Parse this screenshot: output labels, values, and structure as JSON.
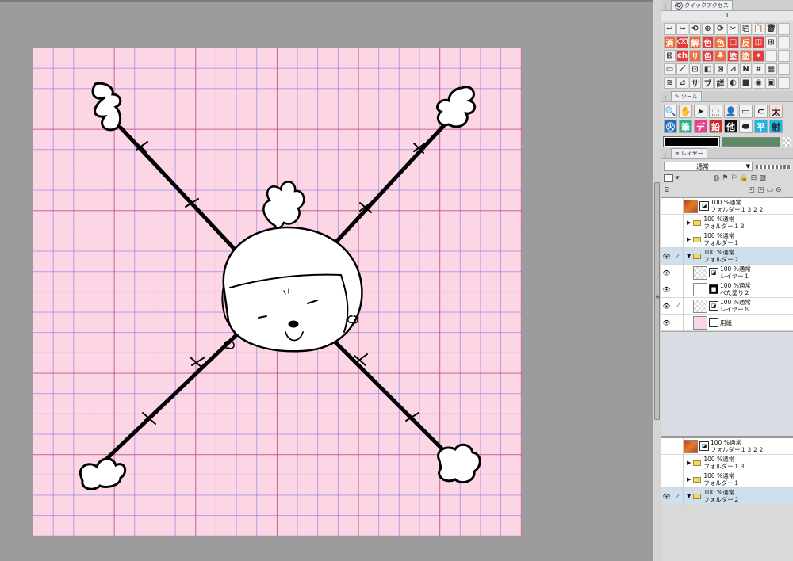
{
  "canvas": {
    "paper_color": "#fdd6e6",
    "ink_color": "#000000"
  },
  "quick_access": {
    "tab_label": "クイックアクセス",
    "set_number": "1",
    "rows": [
      [
        "↩",
        "↪",
        "⟲",
        "⊕",
        "⟳",
        "✂",
        "⎘",
        "📋",
        "🗑",
        "",
        ""
      ],
      [
        "消",
        "⌫",
        "解",
        "色",
        "色",
        "□",
        "反",
        "◫",
        "⊞",
        "",
        ""
      ],
      [
        "⊠",
        "ch",
        "サ",
        "色",
        "♣",
        "塗",
        "塗",
        "⌖",
        "",
        "",
        ""
      ],
      [
        "▭",
        "⟋",
        "⊡",
        "◧",
        "⊠",
        "⊿",
        "N",
        "⌗",
        "▦",
        "",
        ""
      ],
      [
        "≋",
        "⊿",
        "サ",
        "ブ",
        "詳",
        "◐",
        "■",
        "◉",
        "▣",
        "",
        ""
      ]
    ]
  },
  "tool_palette": {
    "tab_label": "ツール",
    "tools_row1": [
      "🔍",
      "✋",
      "➤",
      "⬚",
      "👤",
      "▭",
      "⊂",
      "太"
    ],
    "tools_row2": [
      "㊋",
      "筆",
      "デ",
      "鉛",
      "他",
      "⬬",
      "平",
      "射"
    ]
  },
  "layer_palette": {
    "tab_label": "レイヤー",
    "blend_mode": "通常",
    "layers": [
      {
        "name": "フォルダー１３２２",
        "mode": "100 %通常",
        "kind": "folder-thumb",
        "selected": false,
        "visible": false
      },
      {
        "name": "フォルダー１３",
        "mode": "100 %通常",
        "kind": "folder",
        "selected": false,
        "visible": false
      },
      {
        "name": "フォルダー１",
        "mode": "100 %通常",
        "kind": "folder",
        "selected": false,
        "visible": false
      },
      {
        "name": "フォルダー２",
        "mode": "100 %通常",
        "kind": "folder-open",
        "selected": true,
        "visible": true
      },
      {
        "name": "レイヤー１",
        "mode": "100 %通常",
        "kind": "raster",
        "selected": false,
        "visible": true
      },
      {
        "name": "べた塗り２",
        "mode": "100 %通常",
        "kind": "fill",
        "selected": false,
        "visible": true
      },
      {
        "name": "レイヤー６",
        "mode": "100 %通常",
        "kind": "vector",
        "selected": false,
        "visible": true
      },
      {
        "name": "用紙",
        "mode": "",
        "kind": "paper",
        "selected": false,
        "visible": true
      }
    ],
    "layers_bottom": [
      {
        "name": "フォルダー１３２２",
        "mode": "100 %通常",
        "kind": "folder-thumb",
        "selected": false,
        "visible": false
      },
      {
        "name": "フォルダー１３",
        "mode": "100 %通常",
        "kind": "folder",
        "selected": false,
        "visible": false
      },
      {
        "name": "フォルダー１",
        "mode": "100 %通常",
        "kind": "folder",
        "selected": false,
        "visible": false
      },
      {
        "name": "フォルダー２",
        "mode": "100 %通常",
        "kind": "folder-open",
        "selected": true,
        "visible": true
      }
    ]
  }
}
